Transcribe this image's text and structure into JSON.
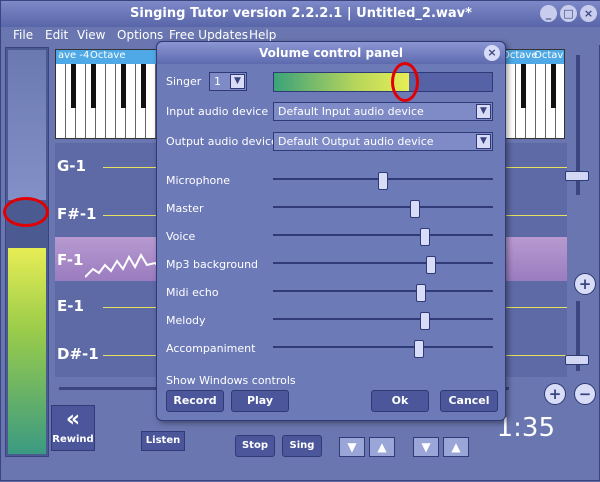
{
  "window": {
    "title": "Singing Tutor version 2.2.2.1 | Untitled_2.wav*",
    "buttons": [
      "_",
      "□",
      "×"
    ]
  },
  "menu": [
    "File",
    "Edit",
    "View",
    "Options",
    "Free Updates",
    "Help"
  ],
  "piano": {
    "octaves": [
      "ave -4",
      "Octave",
      "Octave",
      "Octav"
    ]
  },
  "lanes": [
    "G-1",
    "F#-1",
    "F-1",
    "E-1",
    "D#-1"
  ],
  "bottom": {
    "rewind": "Rewind",
    "listen": "Listen",
    "stop": "Stop",
    "sing": "Sing",
    "time": "1:35"
  },
  "dialog": {
    "title": "Volume control panel",
    "singer_label": "Singer",
    "singer_value": "1",
    "input_label": "Input audio device",
    "input_value": "Default Input audio device",
    "output_label": "Output audio device",
    "output_value": "Default Output audio device",
    "sliders": [
      {
        "label": "Microphone",
        "level": 0.5
      },
      {
        "label": "Master",
        "level": 0.65
      },
      {
        "label": "Voice",
        "level": 0.7
      },
      {
        "label": "Mp3 background",
        "level": 0.73
      },
      {
        "label": "Midi echo",
        "level": 0.68
      },
      {
        "label": "Melody",
        "level": 0.7
      },
      {
        "label": "Accompaniment",
        "level": 0.67
      }
    ],
    "input_level": 0.62,
    "show_windows": "Show Windows controls",
    "record": "Record",
    "play": "Play",
    "ok": "Ok",
    "cancel": "Cancel"
  },
  "colors": {
    "accent": "#5d6aa3",
    "highlight": "#e00000"
  }
}
